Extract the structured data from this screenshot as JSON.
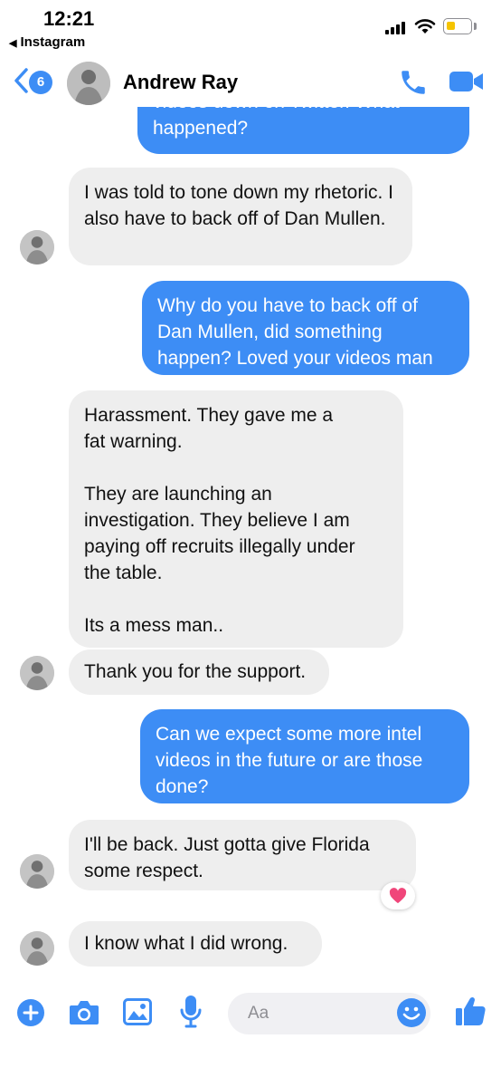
{
  "status_bar": {
    "time": "12:21",
    "back_app": "Instagram"
  },
  "header": {
    "unread_count": "6",
    "contact_name": "Andrew Ray"
  },
  "messages": [
    {
      "from": "me",
      "text": "videos down on Twitter. What happened?"
    },
    {
      "from": "them",
      "text": "I was told to tone down my rhetoric. I also have to back off of Dan Mullen."
    },
    {
      "from": "me",
      "text": "Why do you have to back off of Dan Mullen, did something happen? Loved your videos man"
    },
    {
      "from": "them",
      "text_lines": [
        "Harassment. They gave me a",
        "fat warning.",
        "",
        "They are launching an",
        "investigation. They believe I am",
        "paying off recruits illegally under",
        "the table.",
        "",
        "Its a mess man.."
      ]
    },
    {
      "from": "them",
      "text": "Thank you for the support."
    },
    {
      "from": "me",
      "text": "Can we expect some more intel videos in the future or are those done?"
    },
    {
      "from": "them",
      "text": "I'll be back. Just gotta give Florida some respect.",
      "reaction": "heart-icon"
    },
    {
      "from": "them",
      "text": "I know what I did wrong."
    }
  ],
  "composer": {
    "placeholder": "Aa"
  },
  "icons": [
    "back-chevron-icon",
    "phone-icon",
    "video-camera-icon",
    "plus-icon",
    "camera-icon",
    "image-icon",
    "microphone-icon",
    "smiley-icon",
    "thumbs-up-icon",
    "heart-icon"
  ],
  "colors": {
    "accent": "#3d8df5",
    "incoming_bubble": "#eeeeee",
    "reaction_heart": "#f0467a"
  }
}
